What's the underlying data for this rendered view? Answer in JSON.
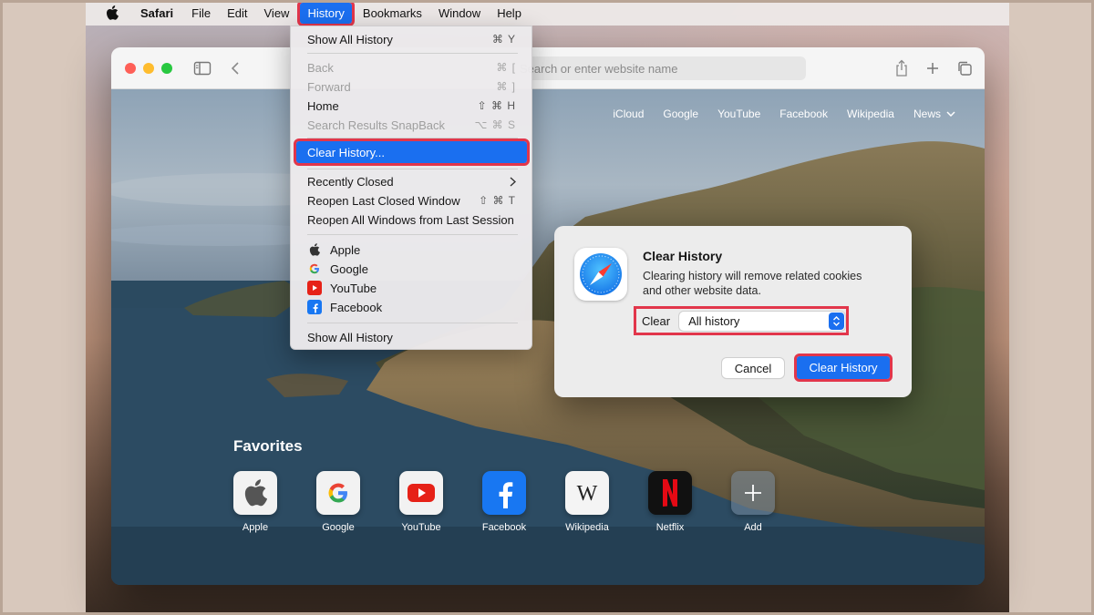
{
  "menubar": {
    "app": "Safari",
    "items": [
      "File",
      "Edit",
      "View",
      "History",
      "Bookmarks",
      "Window",
      "Help"
    ],
    "active": "History"
  },
  "toolbar": {
    "address_placeholder": "Search or enter website name"
  },
  "toplinks": [
    "iCloud",
    "Google",
    "YouTube",
    "Facebook",
    "Wikipedia",
    "News"
  ],
  "history_menu": {
    "show_all_top": {
      "label": "Show All History",
      "shortcut": "⌘ Y"
    },
    "back": {
      "label": "Back",
      "shortcut": "⌘ ["
    },
    "forward": {
      "label": "Forward",
      "shortcut": "⌘ ]"
    },
    "home": {
      "label": "Home",
      "shortcut": "⇧ ⌘ H"
    },
    "snapback": {
      "label": "Search Results SnapBack",
      "shortcut": "⌥ ⌘ S"
    },
    "clear_history": {
      "label": "Clear History..."
    },
    "recently_closed": {
      "label": "Recently Closed"
    },
    "reopen_last": {
      "label": "Reopen Last Closed Window",
      "shortcut": "⇧ ⌘ T"
    },
    "reopen_all": {
      "label": "Reopen All Windows from Last Session"
    },
    "sites": [
      "Apple",
      "Google",
      "YouTube",
      "Facebook"
    ],
    "show_all_bottom": {
      "label": "Show All History"
    }
  },
  "dialog": {
    "title": "Clear History",
    "message": "Clearing history will remove related cookies and other website data.",
    "clear_label": "Clear",
    "clear_value": "All history",
    "cancel": "Cancel",
    "confirm": "Clear History"
  },
  "favorites": {
    "title": "Favorites",
    "items": [
      "Apple",
      "Google",
      "YouTube",
      "Facebook",
      "Wikipedia",
      "Netflix",
      "Add"
    ]
  },
  "colors": {
    "highlight_outline": "#e2364b",
    "accent_blue": "#1a6ff0"
  }
}
